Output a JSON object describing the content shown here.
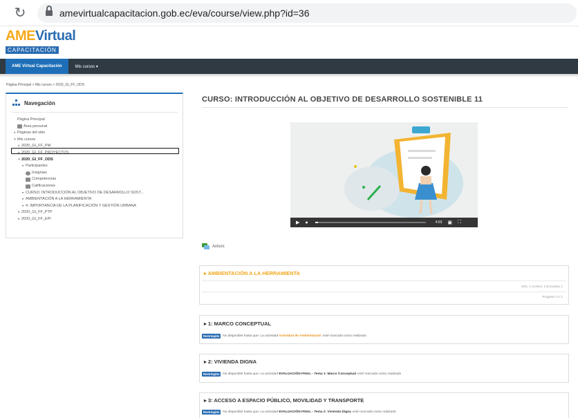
{
  "browser": {
    "url": "amevirtualcapacitacion.gob.ec/eva/course/view.php?id=36"
  },
  "logo": {
    "top_a": "AME",
    "top_b": "Virtual",
    "bottom": "CAPACITACIÓN"
  },
  "navbar": {
    "brand": "AME Virtual Capacitación",
    "menu": "Mis cursos ▾"
  },
  "breadcrumb": "Página Principal  >  Mis cursos  >  2020_GI_FF_ODS",
  "navigation": {
    "title": "Navegación",
    "items": [
      {
        "label": "Página Principal",
        "indent": 0,
        "arrow": "",
        "icon": ""
      },
      {
        "label": "Área personal",
        "indent": 0,
        "arrow": "",
        "icon": "dashboard-icon"
      },
      {
        "label": "Páginas del sitio",
        "indent": 0,
        "arrow": "▸",
        "icon": ""
      },
      {
        "label": "Mis cursos",
        "indent": 0,
        "arrow": "▾",
        "icon": ""
      },
      {
        "label": "2020_GI_FF_PM",
        "indent": 1,
        "arrow": "▸",
        "icon": ""
      },
      {
        "label": "2020_GI_FF_PROYECTOS",
        "indent": 1,
        "arrow": "▸",
        "icon": ""
      },
      {
        "label": "2020_GI_FF_ODS",
        "indent": 1,
        "arrow": "▾",
        "icon": "",
        "bold": true
      },
      {
        "label": "Participantes",
        "indent": 2,
        "arrow": "▸",
        "icon": ""
      },
      {
        "label": "Insignias",
        "indent": 2,
        "arrow": "",
        "icon": "badge-icon"
      },
      {
        "label": "Competencias",
        "indent": 2,
        "arrow": "",
        "icon": "competency-icon"
      },
      {
        "label": "Calificaciones",
        "indent": 2,
        "arrow": "",
        "icon": "grades-icon"
      },
      {
        "label": "CURSO: INTRODUCCIÓN AL OBJETIVO DE DESARROLLO SOST...",
        "indent": 2,
        "arrow": "▸",
        "icon": ""
      },
      {
        "label": "AMBIENTACIÓN A LA HERRAMIENTA",
        "indent": 2,
        "arrow": "▸",
        "icon": ""
      },
      {
        "label": "4. IMPORTANCIA DE LA PLANIFICACIÓN Y GESTIÓN URBANA",
        "indent": 2,
        "arrow": "▸",
        "icon": ""
      },
      {
        "label": "2020_GI_FF_PTP",
        "indent": 1,
        "arrow": "▸",
        "icon": ""
      },
      {
        "label": "2020_GI_FF_EPI",
        "indent": 1,
        "arrow": "▸",
        "icon": ""
      }
    ]
  },
  "course": {
    "title": "CURSO: INTRODUCCIÓN AL OBJETIVO DE DESARROLLO SOSTENIBLE 11",
    "video_time": "4:03",
    "video_progress": 0.03,
    "avisos": "Avisos"
  },
  "sections": [
    {
      "title": "▸ AMBIENTACIÓN A LA HERRAMIENTA",
      "meta1": "URL: 1  Archivo: 1  Encuesta: 1",
      "meta2": "Progreso: 0 / 1"
    },
    {
      "title": "▸ 1: MARCO CONCEPTUAL",
      "badge": "Restringido",
      "pre": "No disponible hasta que: La actividad",
      "activity": "Actividad de Ambientación",
      "post": "esté marcada como realizada"
    },
    {
      "title": "▸ 2: VIVIENDA DIGNA",
      "badge": "Restringido",
      "pre": "No disponible hasta que: La actividad",
      "activity": "EVALUACIÓN FINAL - Tema 1: Marco Conceptual",
      "post": "esté marcada como realizada"
    },
    {
      "title": "▸ 3: ACCESO A ESPACIO PÚBLICO, MOVILIDAD Y TRANSPORTE",
      "badge": "Restringido",
      "pre": "No disponible hasta que: La actividad",
      "activity": "EVALUACIÓN FINAL - Tema 2: Vivienda Digna",
      "post": "esté marcada como realizada"
    }
  ]
}
